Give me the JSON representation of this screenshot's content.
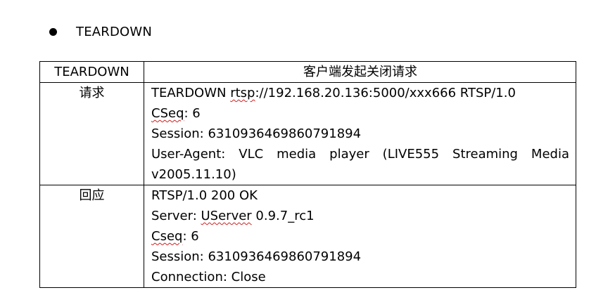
{
  "bullet": {
    "text": "TEARDOWN"
  },
  "table": {
    "header": {
      "left": "TEARDOWN",
      "right": "客户端发起关闭请求"
    },
    "request": {
      "label": "请求",
      "line1_rest": "TEARDOWN ",
      "line1_squiggle": "rtsp",
      "line1_tail": "://192.168.20.136:5000/xxx666 RTSP/1.0",
      "line2_squiggle": "CSeq",
      "line2_tail": ": 6",
      "line3": "Session: 6310936469860791894",
      "line4": "User-Agent: VLC media player (LIVE555 Streaming Media",
      "line5": "v2005.11.10)"
    },
    "response": {
      "label": "回应",
      "line1": "RTSP/1.0 200 OK",
      "line2_head": "Server: ",
      "line2_squiggle": "UServer",
      "line2_tail": " 0.9.7_rc1",
      "line3_squiggle": "Cseq",
      "line3_tail": ": 6",
      "line4": "Session: 6310936469860791894",
      "line5": "Connection: Close"
    }
  }
}
